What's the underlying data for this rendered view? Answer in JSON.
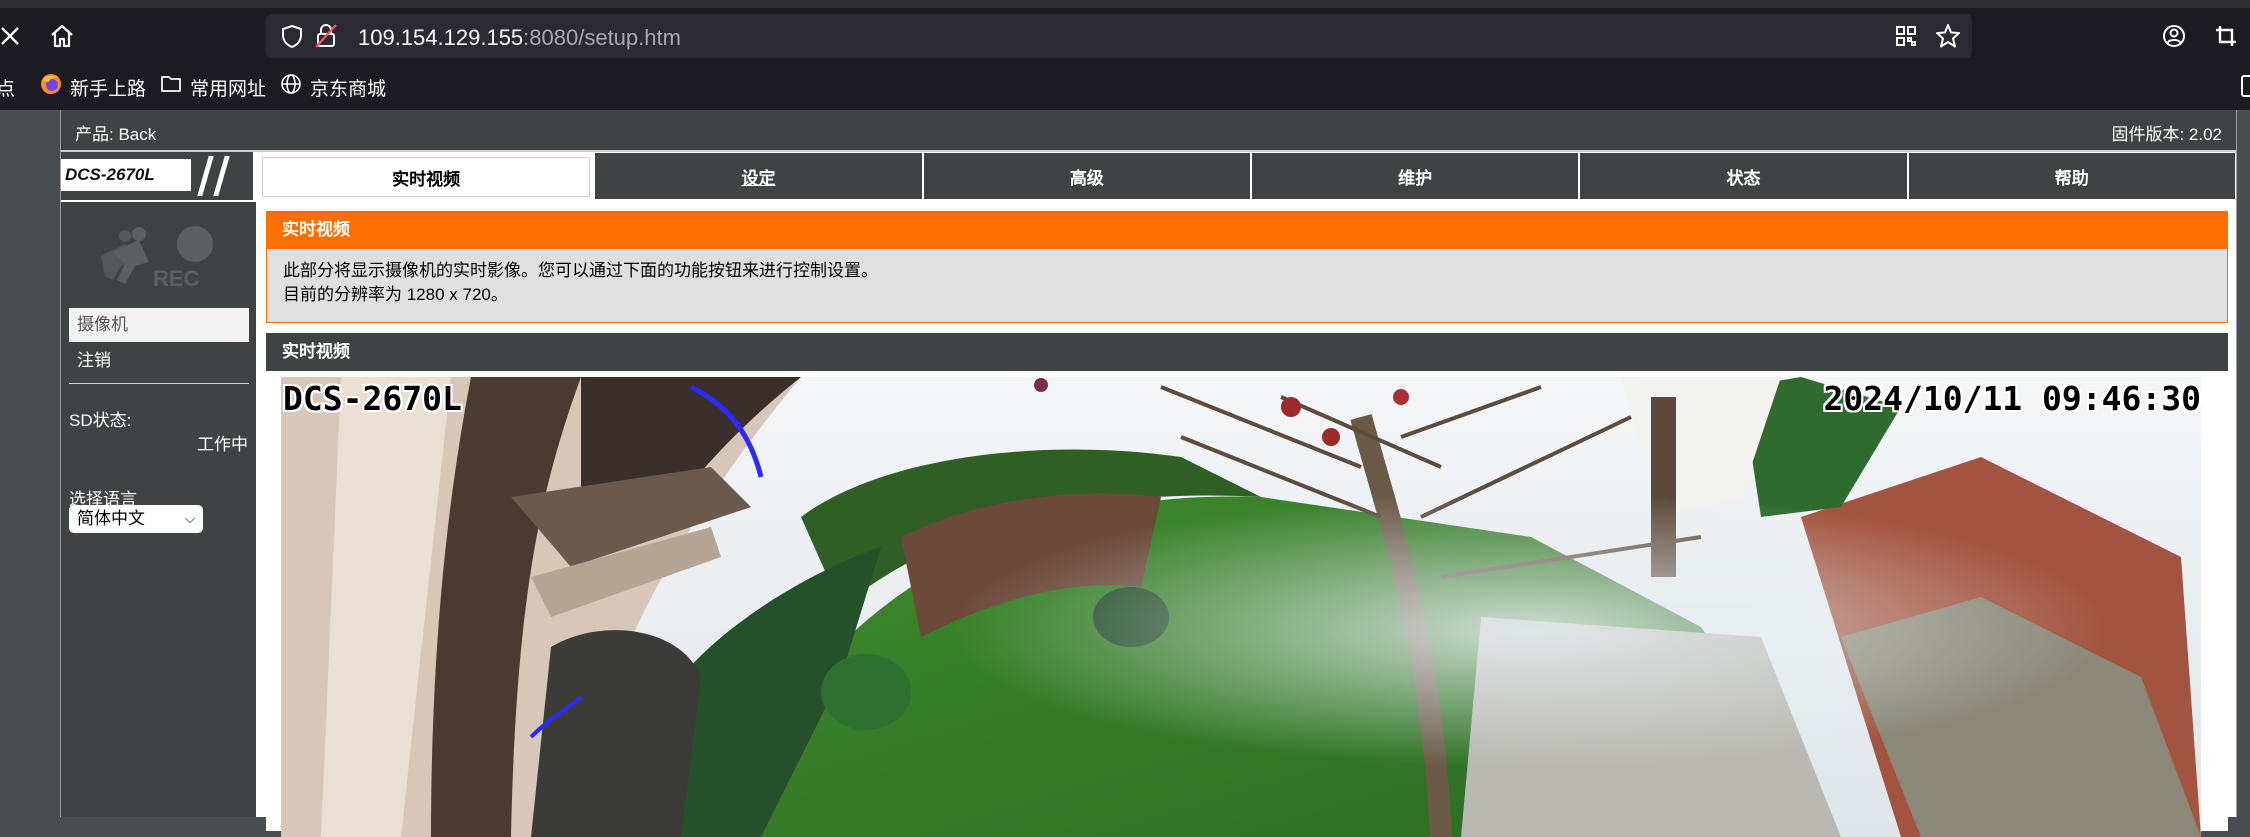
{
  "browser": {
    "url_host": "109.154.129.155",
    "url_rest": ":8080/setup.htm",
    "bookmarks": [
      {
        "label": "点",
        "icon": "bookmark-icon"
      },
      {
        "label": "新手上路",
        "icon": "firefox-icon"
      },
      {
        "label": "常用网址",
        "icon": "folder-icon"
      },
      {
        "label": "京东商城",
        "icon": "globe-icon"
      }
    ]
  },
  "header": {
    "product": "产品: Back",
    "firmware": "固件版本: 2.02"
  },
  "logo": {
    "model": "DCS-2670L"
  },
  "tabs": [
    {
      "label": "实时视频"
    },
    {
      "label": "设定"
    },
    {
      "label": "高级"
    },
    {
      "label": "维护"
    },
    {
      "label": "状态"
    },
    {
      "label": "帮助"
    }
  ],
  "sidebar": {
    "logo_text": "REC",
    "menu": [
      {
        "label": "摄像机"
      },
      {
        "label": "注销"
      }
    ],
    "sd_label": "SD状态:",
    "sd_value": "工作中",
    "language_label": "选择语言",
    "language_value": "简体中文"
  },
  "main": {
    "info_title": "实时视频",
    "info_line1": "此部分将显示摄像机的实时影像。您可以通过下面的功能按钮来进行控制设置。",
    "info_line2": "目前的分辨率为 1280 x 720。",
    "video_title": "实时视频",
    "osd_camera": "DCS-2670L",
    "osd_timestamp": "2024/10/11 09:46:30"
  },
  "colors": {
    "accent_orange": "#ff6f00",
    "panel_dark": "#404344",
    "browser_bg": "#1c1b22"
  }
}
